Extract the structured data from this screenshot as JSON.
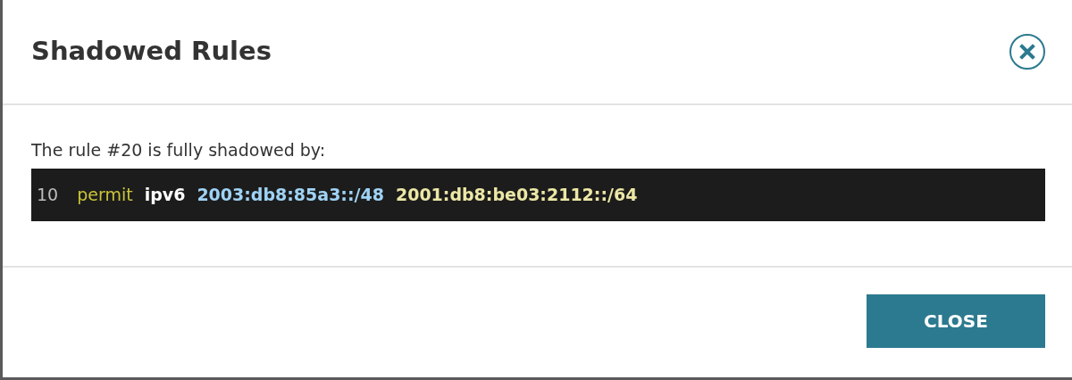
{
  "dialog": {
    "title": "Shadowed Rules",
    "message": "The rule #20 is fully shadowed by:",
    "rule_tokens": [
      {
        "kind": "index",
        "text": "10"
      },
      {
        "kind": "action",
        "text": "permit"
      },
      {
        "kind": "protocol",
        "text": "ipv6"
      },
      {
        "kind": "source",
        "text": "2003:db8:85a3::/48"
      },
      {
        "kind": "destination",
        "text": "2001:db8:be03:2112::/64"
      }
    ],
    "buttons": [
      {
        "label": "CLOSE"
      }
    ]
  }
}
